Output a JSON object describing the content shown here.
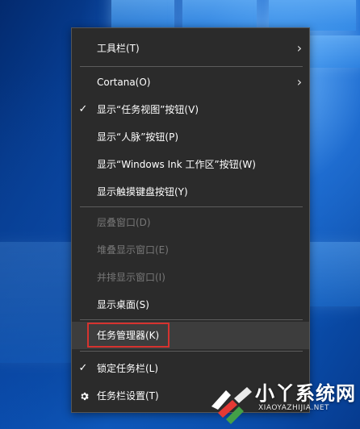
{
  "menu": {
    "items": [
      {
        "label": "工具栏(T)",
        "checked": false,
        "submenu": true,
        "enabled": true,
        "icon": "none"
      },
      {
        "label": "Cortana(O)",
        "checked": false,
        "submenu": true,
        "enabled": true,
        "icon": "none"
      },
      {
        "label": "显示“任务视图”按钮(V)",
        "checked": true,
        "submenu": false,
        "enabled": true,
        "icon": "none"
      },
      {
        "label": "显示“人脉”按钮(P)",
        "checked": false,
        "submenu": false,
        "enabled": true,
        "icon": "none"
      },
      {
        "label": "显示“Windows Ink 工作区”按钮(W)",
        "checked": false,
        "submenu": false,
        "enabled": true,
        "icon": "none"
      },
      {
        "label": "显示触摸键盘按钮(Y)",
        "checked": false,
        "submenu": false,
        "enabled": true,
        "icon": "none"
      },
      {
        "label": "层叠窗口(D)",
        "checked": false,
        "submenu": false,
        "enabled": false,
        "icon": "none"
      },
      {
        "label": "堆叠显示窗口(E)",
        "checked": false,
        "submenu": false,
        "enabled": false,
        "icon": "none"
      },
      {
        "label": "并排显示窗口(I)",
        "checked": false,
        "submenu": false,
        "enabled": false,
        "icon": "none"
      },
      {
        "label": "显示桌面(S)",
        "checked": false,
        "submenu": false,
        "enabled": true,
        "icon": "none"
      },
      {
        "label": "任务管理器(K)",
        "checked": false,
        "submenu": false,
        "enabled": true,
        "icon": "none",
        "highlighted": true
      },
      {
        "label": "锁定任务栏(L)",
        "checked": true,
        "submenu": false,
        "enabled": true,
        "icon": "none"
      },
      {
        "label": "任务栏设置(T)",
        "checked": false,
        "submenu": false,
        "enabled": true,
        "icon": "gear-icon"
      }
    ]
  },
  "glyphs": {
    "check": "✓",
    "submenu_arrow": "›"
  },
  "watermark": {
    "brand": "小丫系统网",
    "site": "XIAOYAZHIJIA.NET"
  },
  "colors": {
    "menu_bg": "#2b2b2b",
    "menu_text": "#ffffff",
    "menu_disabled_text": "#777777",
    "highlight_box": "#d6332f",
    "desktop_blue": "#0a4fb3"
  }
}
